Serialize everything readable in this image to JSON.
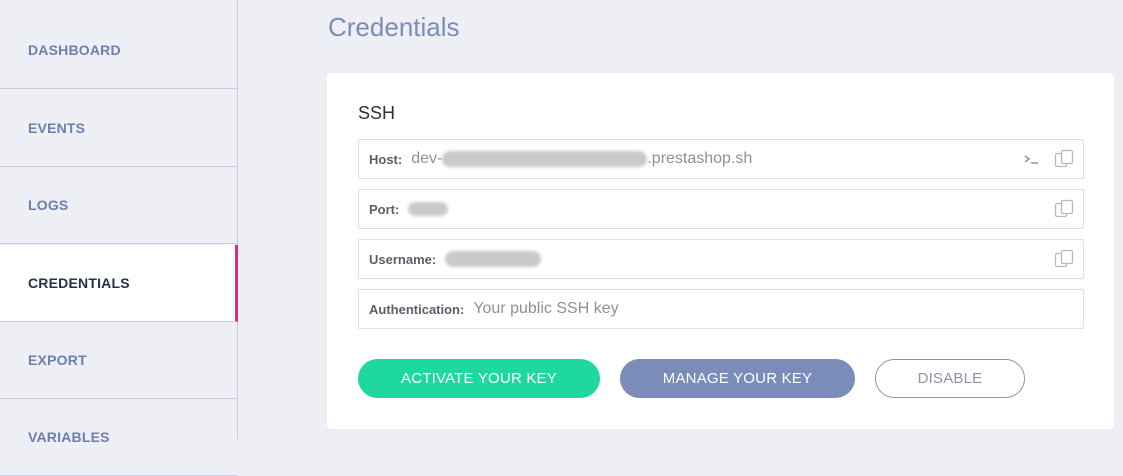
{
  "sidebar": {
    "items": [
      {
        "label": "DASHBOARD"
      },
      {
        "label": "EVENTS"
      },
      {
        "label": "LOGS"
      },
      {
        "label": "CREDENTIALS",
        "active": true
      },
      {
        "label": "EXPORT"
      },
      {
        "label": "VARIABLES"
      }
    ]
  },
  "page": {
    "title": "Credentials"
  },
  "ssh": {
    "title": "SSH",
    "host": {
      "label": "Host:",
      "value_prefix": "dev-",
      "value_suffix": ".prestashop.sh"
    },
    "port": {
      "label": "Port:"
    },
    "username": {
      "label": "Username:"
    },
    "authentication": {
      "label": "Authentication:",
      "value": "Your public SSH key"
    }
  },
  "icons": {
    "terminal": "terminal-icon",
    "copy": "copy-icon"
  },
  "buttons": {
    "activate": "ACTIVATE YOUR KEY",
    "manage": "MANAGE YOUR KEY",
    "disable": "DISABLE"
  },
  "colors": {
    "accent_active": "#d6337a",
    "primary_green": "#1fd8a0",
    "secondary_blue": "#7b8cba",
    "nav_text": "#6c7fae"
  }
}
